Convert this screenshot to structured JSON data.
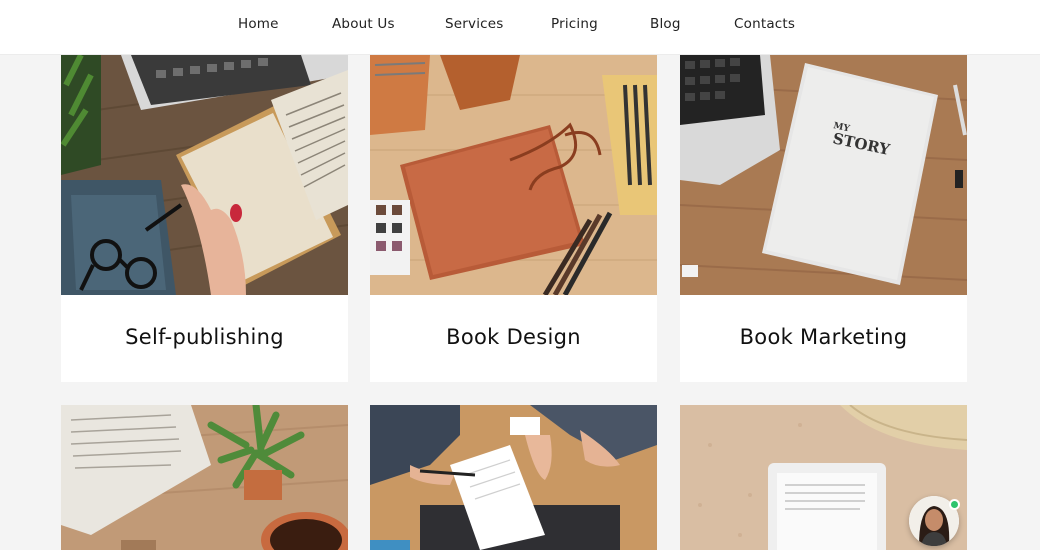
{
  "nav": {
    "items": [
      {
        "label": "Home"
      },
      {
        "label": "About Us"
      },
      {
        "label": "Services"
      },
      {
        "label": "Pricing"
      },
      {
        "label": "Blog"
      },
      {
        "label": "Contacts"
      }
    ]
  },
  "services": [
    {
      "title": "Self-publishing",
      "image": "desk-open-book-typewriter"
    },
    {
      "title": "Book Design",
      "image": "leather-notebook-pencils"
    },
    {
      "title": "Book Marketing",
      "image": "my-story-book-laptop"
    },
    {
      "image": "open-book-succulent-coffee"
    },
    {
      "image": "business-handshake-documents"
    },
    {
      "image": "ebook-reader-on-sand"
    }
  ],
  "book_cover_text": {
    "line1": "MY",
    "line2": "STORY"
  },
  "chat": {
    "status": "online",
    "status_color": "#2ec46d"
  }
}
